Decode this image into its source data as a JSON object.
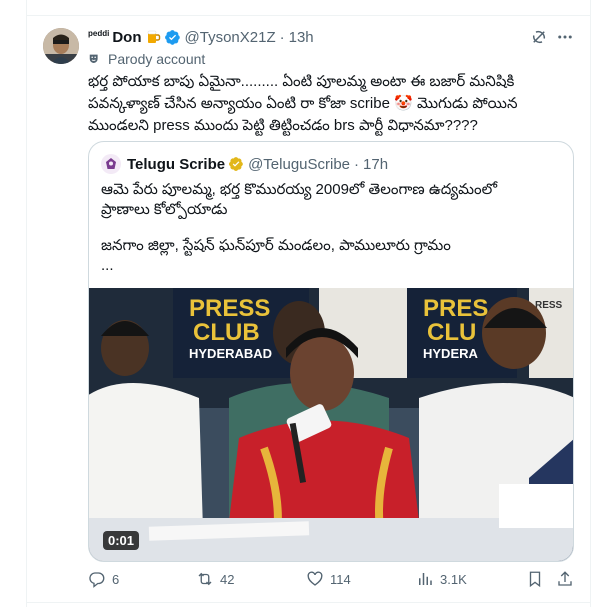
{
  "tweet": {
    "display_name_prefix": "peddi",
    "display_name": "Don",
    "badge_icon": "beer-mug-icon",
    "verified_icon": "verified-badge-icon",
    "handle": "@TysonX21Z",
    "separator": "·",
    "time": "13h",
    "account_label": "Parody account",
    "text_lines": [
      "భర్త పోయాక బాపు ఏమైనా......... ఏంటి పూలమ్మ అంటా ఈ బజార్ మనిషికి",
      "పవన్కళ్యాణ్ చేసిన అన్యాయం ఏంటి రా కోజా scribe 🤡 మొగుడు పోయిన",
      "ముండలని press ముందు పెట్టి తిట్టించడం brs పార్టీ విధానమా????"
    ]
  },
  "quote": {
    "name": "Telugu Scribe",
    "handle": "@TeluguScribe",
    "separator": "·",
    "time": "17h",
    "verified_icon": "gold-verified-badge-icon",
    "text_lines": [
      "ఆమె పేరు పూలమ్మ, భర్త కొమురయ్య 2009లో తెలంగాణ ఉద్యమంలో",
      "ప్రాణాలు కోల్పోయాడు"
    ],
    "text_lines_2": [
      "జనగాం జిల్లా, స్టేషన్ ఘన్‌పూర్ మండలం, పాములూరు గ్రామం",
      "..."
    ],
    "media": {
      "duration": "0:01",
      "banner_words": [
        "PRESS",
        "CLUB",
        "HYDERABAD",
        "PRES",
        "CLU",
        "HYDERA",
        "RESS"
      ]
    }
  },
  "actions": {
    "replies": "6",
    "reposts": "42",
    "likes": "114",
    "views": "3.1K"
  },
  "colors": {
    "text": "#0f1419",
    "secondary": "#536471",
    "verified_blue": "#1d9bf0",
    "verified_gold": "#e2b719",
    "border": "#cfd9de"
  }
}
